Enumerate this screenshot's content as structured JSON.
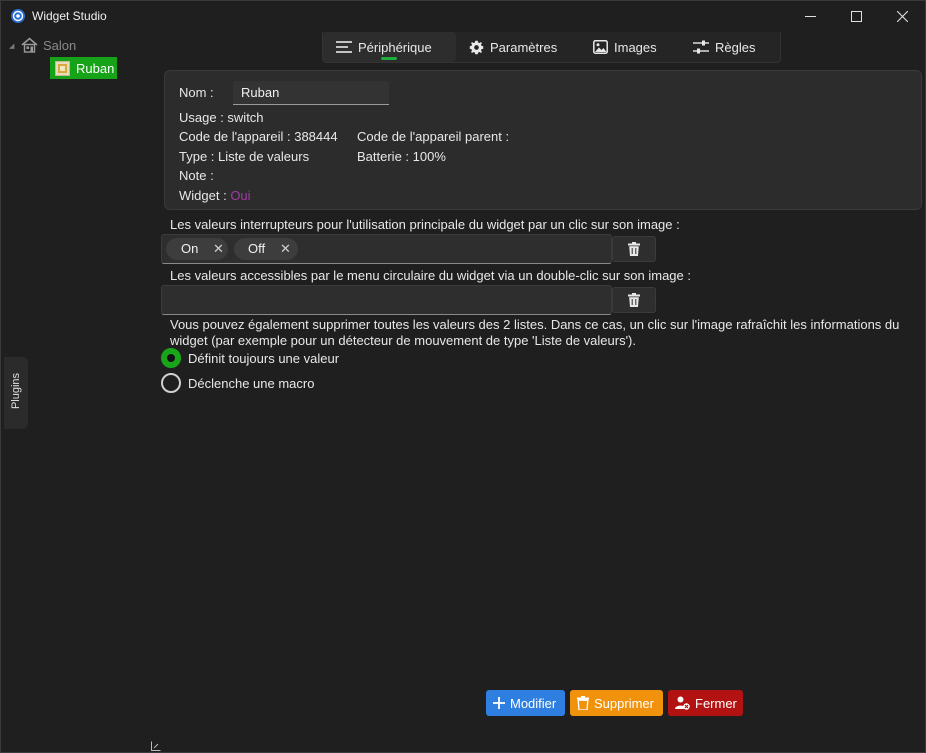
{
  "window": {
    "title": "Widget Studio"
  },
  "tree": {
    "root": {
      "label": "Salon",
      "icon": "house-icon"
    },
    "child": {
      "label": "Ruban",
      "icon": "device-icon",
      "accent": "#17a317"
    }
  },
  "side_tab": {
    "label": "Plugins"
  },
  "tabs": [
    {
      "label": "Périphérique",
      "icon": "menu-lines-icon",
      "active": true
    },
    {
      "label": "Paramètres",
      "icon": "gear-icon"
    },
    {
      "label": "Images",
      "icon": "image-icon"
    },
    {
      "label": "Règles",
      "icon": "sliders-icon"
    }
  ],
  "device": {
    "name_label": "Nom :",
    "name_value": "Ruban",
    "usage": "Usage : switch",
    "code": "Code de l'appareil : 388444",
    "parent_code": "Code de l'appareil parent :",
    "type": "Type : Liste de valeurs",
    "battery": "Batterie : 100%",
    "note": "Note :",
    "widget_label": "Widget :",
    "widget_value": "Oui",
    "widget_value_color": "#a23aa5"
  },
  "switch_values": {
    "description": "Les valeurs interrupteurs pour l'utilisation principale du widget par un clic sur son image :",
    "chips": [
      "On",
      "Off"
    ]
  },
  "menu_values": {
    "description": "Les valeurs accessibles par le menu circulaire du widget via un double-clic sur son image :",
    "chips": []
  },
  "info_text": "Vous pouvez également supprimer toutes les valeurs des 2 listes. Dans ce cas, un clic sur l'image rafraîchit les informations du widget (par exemple pour un détecteur de mouvement de type 'Liste de valeurs').",
  "options": [
    {
      "label": "Définit toujours une valeur",
      "checked": true
    },
    {
      "label": "Déclenche une macro",
      "checked": false
    }
  ],
  "actions": {
    "modify": {
      "label": "Modifier",
      "color": "#2f7fe0"
    },
    "delete": {
      "label": "Supprimer",
      "color": "#f0920c"
    },
    "close": {
      "label": "Fermer",
      "color": "#b31212"
    }
  }
}
